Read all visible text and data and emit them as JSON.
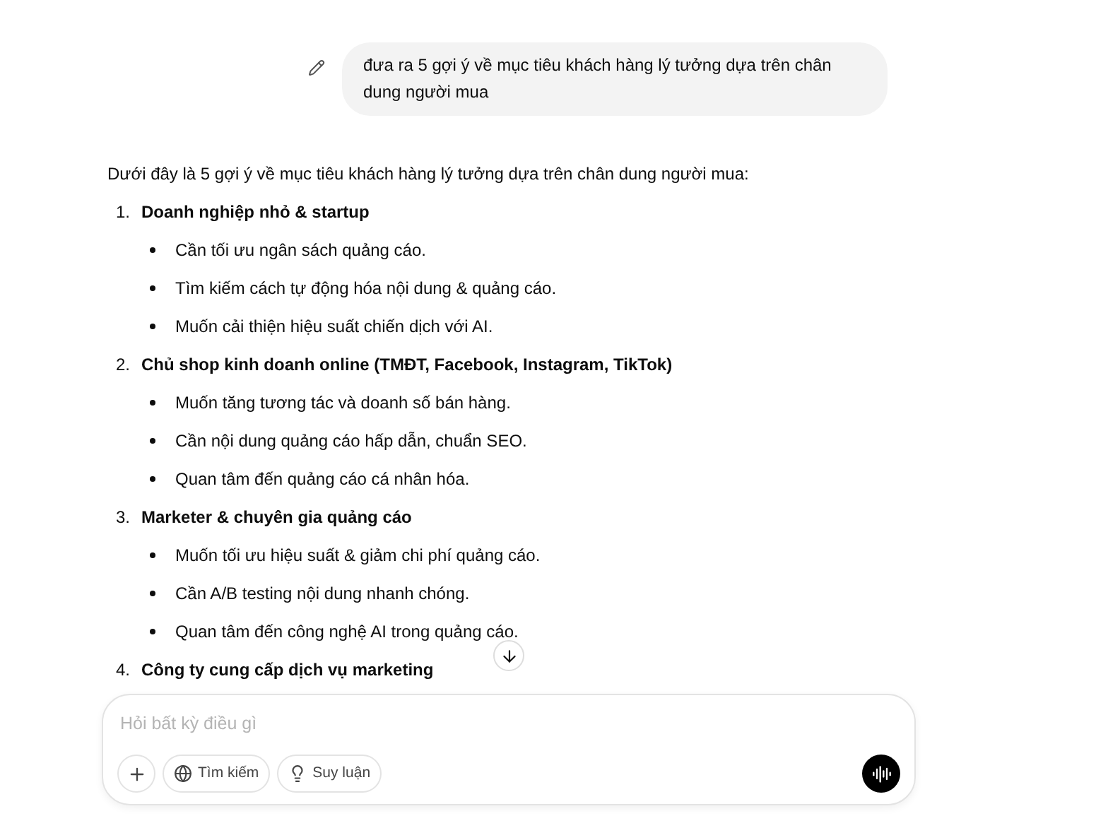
{
  "user_message": {
    "text": "đưa ra 5 gợi ý về mục tiêu khách hàng lý tưởng dựa trên chân dung người mua"
  },
  "answer": {
    "intro": "Dưới đây là 5 gợi ý về mục tiêu khách hàng lý tưởng dựa trên chân dung người mua:",
    "items": [
      {
        "number": "1.",
        "title": "Doanh nghiệp nhỏ & startup",
        "bullets": [
          "Cần tối ưu ngân sách quảng cáo.",
          "Tìm kiếm cách tự động hóa nội dung & quảng cáo.",
          "Muốn cải thiện hiệu suất chiến dịch với AI."
        ]
      },
      {
        "number": "2.",
        "title": "Chủ shop kinh doanh online (TMĐT, Facebook, Instagram, TikTok)",
        "bullets": [
          "Muốn tăng tương tác và doanh số bán hàng.",
          "Cần nội dung quảng cáo hấp dẫn, chuẩn SEO.",
          "Quan tâm đến quảng cáo cá nhân hóa."
        ]
      },
      {
        "number": "3.",
        "title": "Marketer & chuyên gia quảng cáo",
        "bullets": [
          "Muốn tối ưu hiệu suất & giảm chi phí quảng cáo.",
          "Cần A/B testing nội dung nhanh chóng.",
          "Quan tâm đến công nghệ AI trong quảng cáo."
        ]
      },
      {
        "number": "4.",
        "title": "Công ty cung cấp dịch vụ marketing"
      }
    ]
  },
  "composer": {
    "placeholder": "Hỏi bất kỳ điều gì",
    "buttons": [
      {
        "kind": "search",
        "label": "Tìm kiếm"
      },
      {
        "kind": "reason",
        "label": "Suy luận"
      }
    ]
  }
}
